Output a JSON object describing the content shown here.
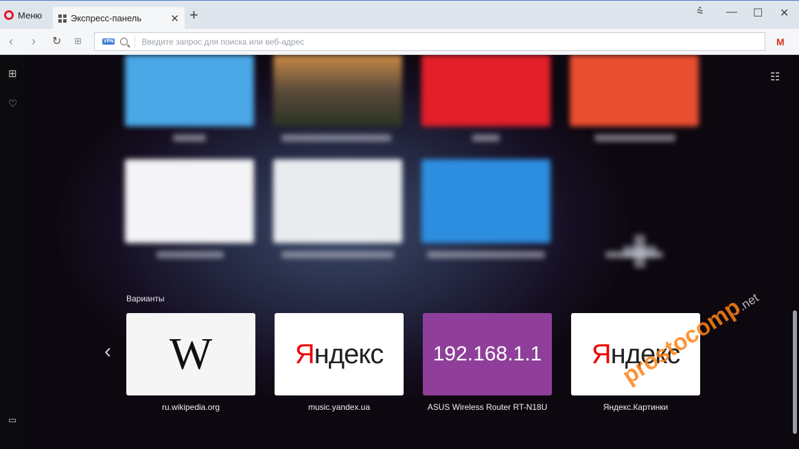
{
  "menu": {
    "label": "Меню"
  },
  "tab": {
    "title": "Экспресс-панель"
  },
  "address": {
    "placeholder": "Введите запрос для поиска или веб-адрес",
    "vpn_badge": "VPN"
  },
  "sidebar": {
    "icons": [
      "speed-dial-icon",
      "heart-icon",
      "panel-icon"
    ]
  },
  "suggestions": {
    "label": "Варианты",
    "items": [
      {
        "caption": "ru.wikipedia.org",
        "tile_text": "W"
      },
      {
        "caption": "music.yandex.ua",
        "tile_text_accent": "Я",
        "tile_text_rest": "ндекс"
      },
      {
        "caption": "ASUS Wireless Router RT-N18U",
        "tile_text": "192.168.1.1"
      },
      {
        "caption": "Яндекс.Картинки",
        "tile_text_accent": "Я",
        "tile_text_rest": "ндекс"
      }
    ]
  },
  "watermark": {
    "main": "prostocomp",
    "suffix": ".net"
  },
  "colors": {
    "accent_opera": "#e0162b",
    "ip_tile": "#8f3f9a",
    "yandex_red": "#e00000"
  }
}
